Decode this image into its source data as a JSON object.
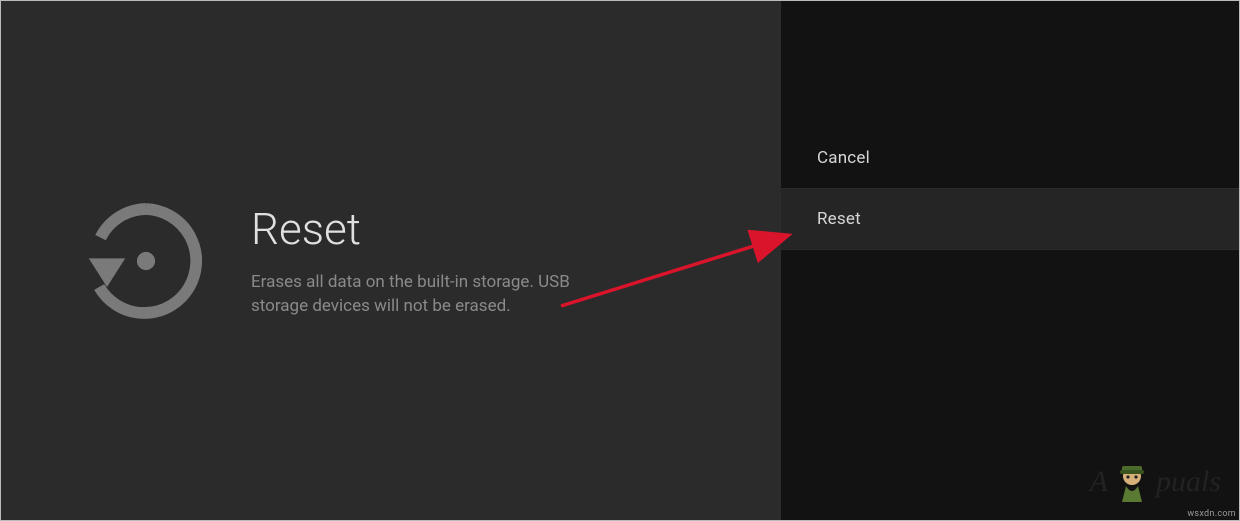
{
  "main": {
    "icon": "restore-icon",
    "title": "Reset",
    "subtitle": "Erases all data on the built-in storage. USB storage devices will not be erased."
  },
  "options": {
    "cancel": "Cancel",
    "reset": "Reset"
  },
  "annotation": {
    "arrow_color": "#d9142b"
  },
  "watermark": {
    "brand_left": "A",
    "brand_right": "puals",
    "mascot": "mascot-icon"
  },
  "attribution": "wsxdn.com"
}
